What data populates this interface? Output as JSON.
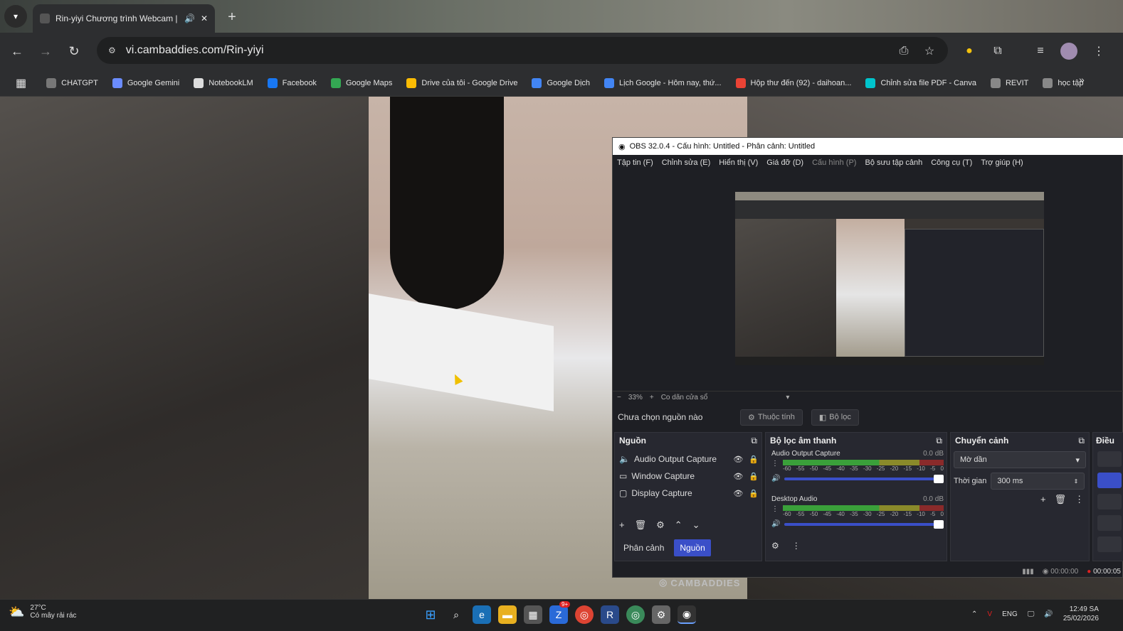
{
  "browser": {
    "tab_title": "Rin-yiyi Chương trình Webcam | Cam",
    "url": "vi.cambaddies.com/Rin-yiyi",
    "bookmarks": [
      {
        "label": "CHATGPT",
        "color": "#777777"
      },
      {
        "label": "Google Gemini",
        "color": "#6b8cff"
      },
      {
        "label": "NotebookLM",
        "color": "#dddddd"
      },
      {
        "label": "Facebook",
        "color": "#1877f2"
      },
      {
        "label": "Google Maps",
        "color": "#34a853"
      },
      {
        "label": "Drive của tôi - Google Drive",
        "color": "#fbbc04"
      },
      {
        "label": "Google Dịch",
        "color": "#4285f4"
      },
      {
        "label": "Lịch Google - Hôm nay, thứ...",
        "color": "#4285f4"
      },
      {
        "label": "Hộp thư đến (92) - daihoan...",
        "color": "#ea4335"
      },
      {
        "label": "Chỉnh sửa file PDF - Canva",
        "color": "#00c4cc"
      },
      {
        "label": "REVIT",
        "color": "#888888"
      },
      {
        "label": "học tập",
        "color": "#888888"
      }
    ]
  },
  "page": {
    "watermark": "CAMBADDIES"
  },
  "obs": {
    "title": "OBS 32.0.4 - Cấu hình: Untitled - Phân cảnh: Untitled",
    "menu": [
      "Tập tin (F)",
      "Chỉnh sửa (E)",
      "Hiển thị (V)",
      "Giá đỡ (D)",
      "Cấu hình (P)",
      "Bộ sưu tập cảnh",
      "Công cụ (T)",
      "Trợ giúp (H)"
    ],
    "zoom": "33%",
    "scale_mode": "Co dãn cửa sổ",
    "no_source": "Chưa chọn nguồn nào",
    "properties_btn": "Thuộc tính",
    "filters_btn": "Bộ lọc",
    "sources": {
      "title": "Nguồn",
      "items": [
        "Audio Output Capture",
        "Window Capture",
        "Display Capture"
      ],
      "tab_scenes": "Phân cảnh",
      "tab_sources": "Nguồn"
    },
    "mixer": {
      "title": "Bộ lọc âm thanh",
      "channels": [
        {
          "name": "Audio Output Capture",
          "db": "0.0 dB",
          "level": 0.55
        },
        {
          "name": "Desktop Audio",
          "db": "0.0 dB",
          "level": 0.62
        }
      ],
      "scale": [
        "-60",
        "-55",
        "-50",
        "-45",
        "-40",
        "-35",
        "-30",
        "-25",
        "-20",
        "-15",
        "-10",
        "-5",
        "0"
      ]
    },
    "transitions": {
      "title": "Chuyển cảnh",
      "type": "Mờ dần",
      "duration_label": "Thời gian",
      "duration": "300 ms"
    },
    "controls_title": "Điều",
    "status": {
      "stream_time": "00:00:00",
      "rec_time": "00:00:05"
    }
  },
  "taskbar": {
    "temp": "27°C",
    "weather": "Có mây rải rác",
    "lang": "ENG",
    "time": "12:49 SA",
    "date": "25/02/2026",
    "badge": "9+"
  }
}
